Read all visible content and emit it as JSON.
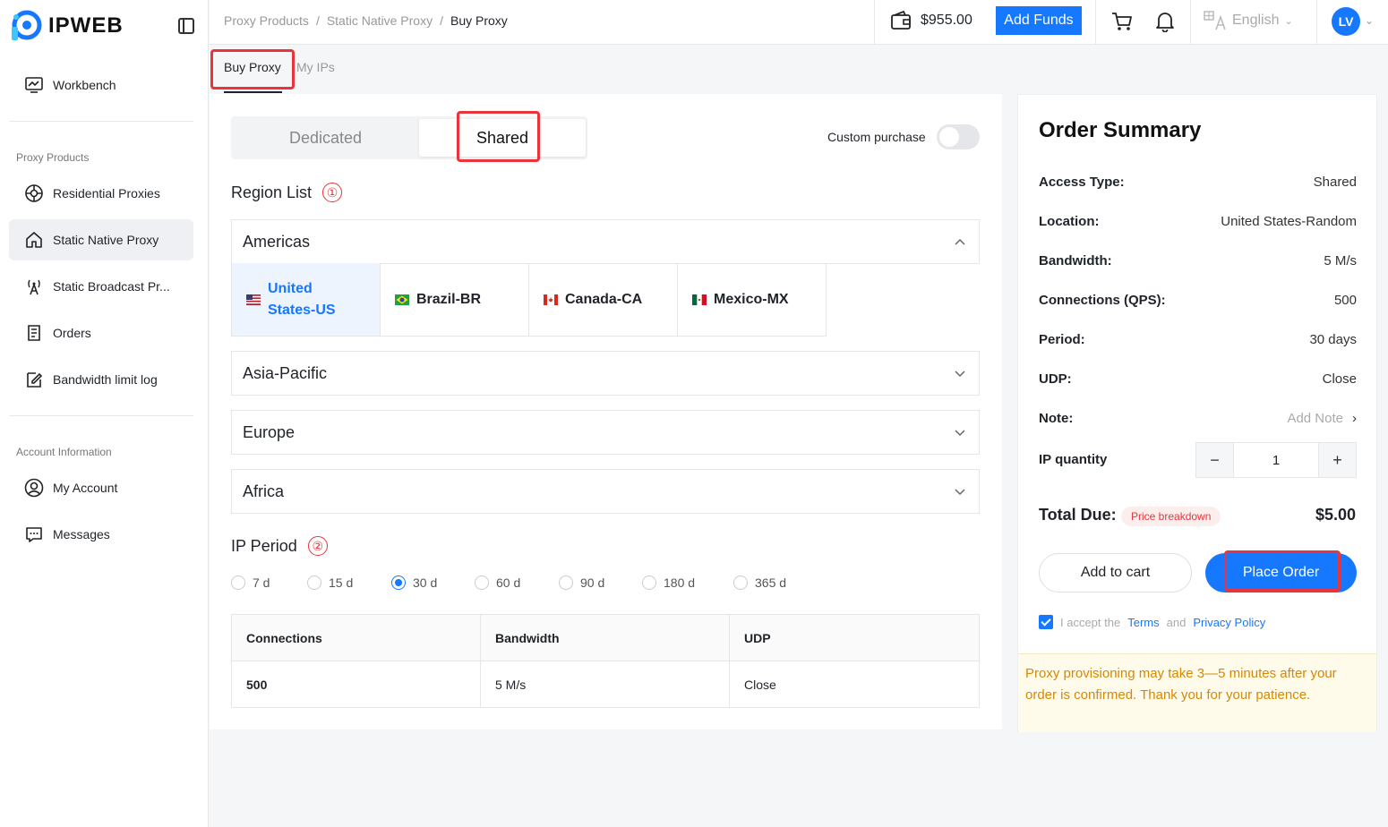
{
  "brand": {
    "name": "IPWEB",
    "accent": "#1677ff",
    "highlight": "#e8343a"
  },
  "sidebar": {
    "items": [
      {
        "label": "Workbench",
        "icon": "monitor-icon"
      },
      {
        "label": "Residential Proxies",
        "icon": "globe-icon"
      },
      {
        "label": "Static Native Proxy",
        "icon": "home-icon"
      },
      {
        "label": "Static Broadcast Pr...",
        "icon": "antenna-icon"
      },
      {
        "label": "Orders",
        "icon": "receipt-icon"
      },
      {
        "label": "Bandwidth limit log",
        "icon": "edit-icon"
      },
      {
        "label": "My Account",
        "icon": "user-icon"
      },
      {
        "label": "Messages",
        "icon": "message-icon"
      }
    ],
    "sections": {
      "proxy": "Proxy Products",
      "account": "Account Information"
    }
  },
  "topbar": {
    "breadcrumb": [
      "Proxy Products",
      "Static Native Proxy",
      "Buy Proxy"
    ],
    "balance": "$955.00",
    "add_funds": "Add Funds",
    "language": "English",
    "avatar": "LV"
  },
  "tabs": {
    "buy": "Buy Proxy",
    "my_ips": "My IPs"
  },
  "purchase": {
    "types": {
      "dedicated": "Dedicated",
      "shared": "Shared"
    },
    "custom_purchase": "Custom purchase",
    "region_title": "Region List",
    "region_num": "①",
    "regions": [
      "Americas",
      "Asia-Pacific",
      "Europe",
      "Africa"
    ],
    "countries": [
      {
        "name": "United States-US",
        "line1": "United",
        "line2": "States-US"
      },
      {
        "name": "Brazil-BR"
      },
      {
        "name": "Canada-CA"
      },
      {
        "name": "Mexico-MX"
      }
    ],
    "period_title": "IP Period",
    "period_num": "②",
    "periods": [
      "7 d",
      "15 d",
      "30 d",
      "60 d",
      "90 d",
      "180 d",
      "365 d"
    ],
    "selected_period": "30 d",
    "table": {
      "headers": [
        "Connections",
        "Bandwidth",
        "UDP"
      ],
      "row": [
        "500",
        "5 M/s",
        "Close"
      ]
    }
  },
  "summary": {
    "title": "Order Summary",
    "rows": [
      {
        "k": "Access Type:",
        "v": "Shared"
      },
      {
        "k": "Location:",
        "v": "United States-Random"
      },
      {
        "k": "Bandwidth:",
        "v": "5 M/s"
      },
      {
        "k": "Connections (QPS):",
        "v": "500"
      },
      {
        "k": "Period:",
        "v": "30 days"
      },
      {
        "k": "UDP:",
        "v": "Close"
      }
    ],
    "note_label": "Note:",
    "note_placeholder": "Add Note",
    "qty_label": "IP quantity",
    "qty": "1",
    "total_label": "Total Due:",
    "breakdown": "Price breakdown",
    "total": "$5.00",
    "add_to_cart": "Add to cart",
    "place_order": "Place Order",
    "terms_prefix": "I accept the",
    "terms_link": "Terms",
    "terms_and": "and",
    "privacy_link": "Privacy Policy",
    "notice": "Proxy provisioning may take 3—5 minutes after your order is confirmed. Thank you for your patience."
  }
}
